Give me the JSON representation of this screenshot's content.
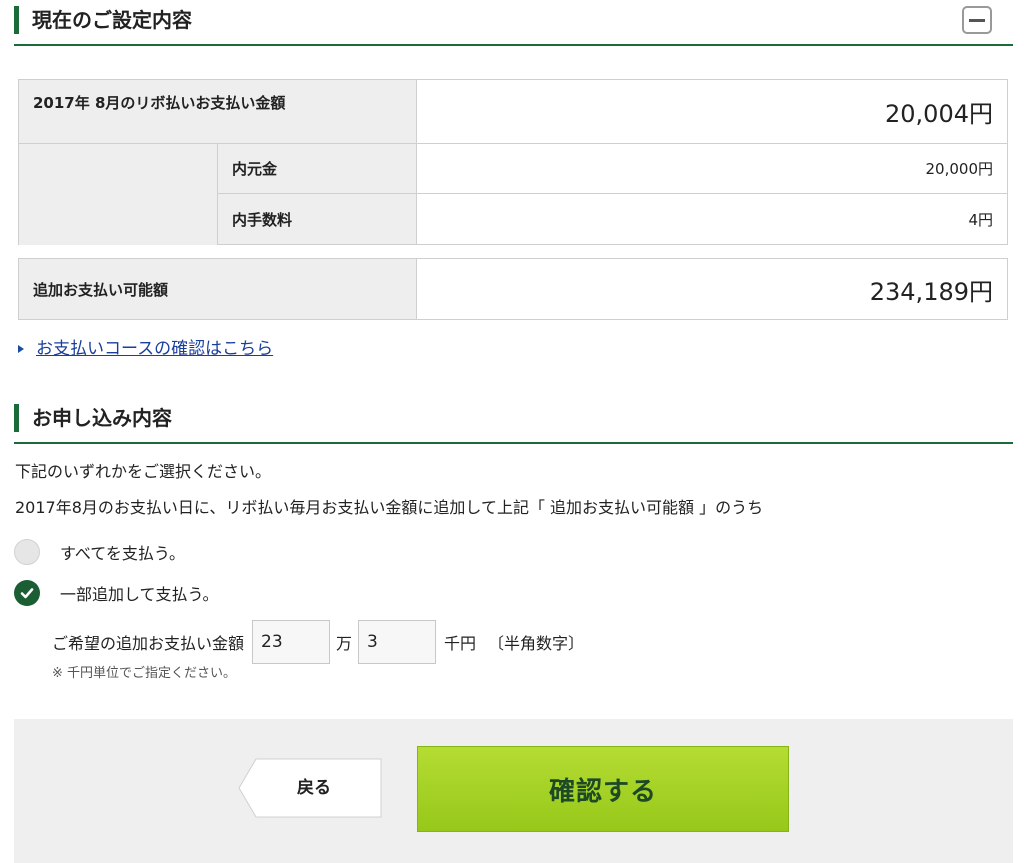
{
  "current_settings": {
    "title": "現在のご設定内容",
    "collapse_icon": "minus-icon",
    "monthly_label": "2017年 8月のリボ払いお支払い金額",
    "monthly_value": "20,004円",
    "principal_label": "内元金",
    "principal_value": "20,000円",
    "fee_label": "内手数料",
    "fee_value": "4円",
    "additional_label": "追加お支払い可能額",
    "additional_value": "234,189円",
    "course_link": "お支払いコースの確認はこちら"
  },
  "application": {
    "title": "お申し込み内容",
    "instruction": "下記のいずれかをご選択ください。",
    "description": "2017年8月のお支払い日に、リボ払い毎月お支払い金額に追加して上記「 追加お支払い可能額 」のうち",
    "options": [
      {
        "label": "すべてを支払う。",
        "selected": false
      },
      {
        "label": "一部追加して支払う。",
        "selected": true
      }
    ],
    "amount_label": "ご希望の追加お支払い金額",
    "man_value": "23",
    "man_unit": "万",
    "sen_value": "3",
    "sen_unit": "千円",
    "format_hint": "〔半角数字〕",
    "note": "※ 千円単位でご指定ください。"
  },
  "buttons": {
    "back": "戻る",
    "confirm": "確認する"
  },
  "colors": {
    "accent_green": "#1b6b3a",
    "confirm_green": "#a6d22a",
    "link_blue": "#1a3e9c"
  }
}
